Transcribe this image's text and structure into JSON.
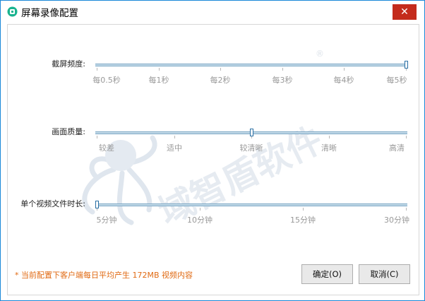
{
  "window": {
    "title": "屏幕录像配置",
    "close_label": "✕"
  },
  "watermark": {
    "text": "域智盾软件",
    "registered": "®"
  },
  "sliders": [
    {
      "label": "截屏频度:",
      "ticks": [
        "每0.5秒",
        "每1秒",
        "每2秒",
        "每3秒",
        "每4秒",
        "每5秒"
      ],
      "selected_index": 5
    },
    {
      "label": "画面质量:",
      "ticks": [
        "较差",
        "适中",
        "较清晰",
        "清晰",
        "高清"
      ],
      "selected_index": 2
    },
    {
      "label": "单个视频文件时长:",
      "ticks": [
        "5分钟",
        "10分钟",
        "15分钟",
        "30分钟"
      ],
      "selected_index": 0
    }
  ],
  "footer": {
    "note": "* 当前配置下客户端每日平均产生 172MB 视频内容",
    "ok_label": "确定(O)",
    "cancel_label": "取消(C)"
  },
  "colors": {
    "accent": "#1a88d8",
    "close_bg": "#c42b1c",
    "note_text": "#e06a13",
    "track_fill": "#c5dbe9"
  }
}
